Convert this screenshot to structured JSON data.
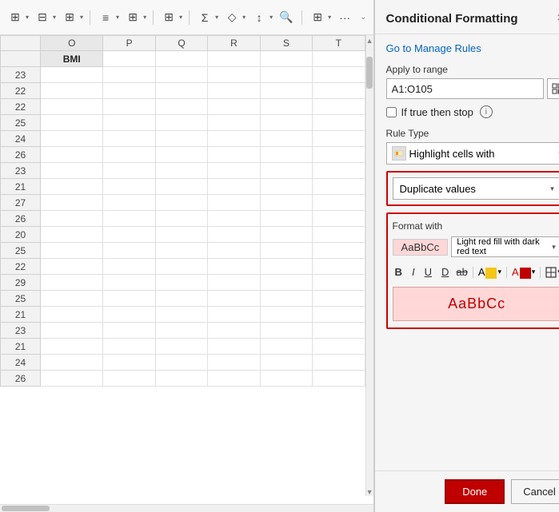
{
  "toolbar": {
    "icons": [
      "⊞",
      "⊟",
      "⊞",
      "≡",
      "⊞",
      "⊞",
      "Σ",
      "◇",
      "↕",
      "🔍",
      "⊞",
      "···"
    ]
  },
  "spreadsheet": {
    "columns": [
      "O",
      "P",
      "Q",
      "R",
      "S",
      "T"
    ],
    "header_row": "BMI",
    "rows": [
      {
        "row_num": "23",
        "o_val": ""
      },
      {
        "row_num": "22",
        "o_val": ""
      },
      {
        "row_num": "22",
        "o_val": ""
      },
      {
        "row_num": "25",
        "o_val": ""
      },
      {
        "row_num": "24",
        "o_val": ""
      },
      {
        "row_num": "26",
        "o_val": ""
      },
      {
        "row_num": "23",
        "o_val": ""
      },
      {
        "row_num": "21",
        "o_val": ""
      },
      {
        "row_num": "27",
        "o_val": ""
      },
      {
        "row_num": "26",
        "o_val": ""
      },
      {
        "row_num": "20",
        "o_val": ""
      },
      {
        "row_num": "25",
        "o_val": ""
      },
      {
        "row_num": "22",
        "o_val": ""
      },
      {
        "row_num": "29",
        "o_val": ""
      },
      {
        "row_num": "25",
        "o_val": ""
      },
      {
        "row_num": "21",
        "o_val": ""
      },
      {
        "row_num": "23",
        "o_val": ""
      },
      {
        "row_num": "21",
        "o_val": ""
      },
      {
        "row_num": "24",
        "o_val": ""
      },
      {
        "row_num": "26",
        "o_val": ""
      }
    ]
  },
  "panel": {
    "title": "Conditional Formatting",
    "close_label": "×",
    "manage_rules_link": "Go to Manage Rules",
    "apply_to_range_label": "Apply to range",
    "range_value": "A1:O105",
    "if_true_then_stop_label": "If true then stop",
    "rule_type_label": "Rule Type",
    "rule_type_icon_label": "⊞",
    "rule_type_value": "Highlight cells with",
    "duplicate_values_label": "Duplicate values",
    "format_with_label": "Format with",
    "format_preview_label": "AaBbCc",
    "format_desc_value": "Light red fill with dark red text",
    "preview_text": "AaBbCc",
    "format_toolbar": {
      "bold": "B",
      "italic": "I",
      "underline": "U",
      "underline2": "D",
      "strikethrough": "ab",
      "fill_color": "A",
      "text_color": "A",
      "borders": "⊞"
    },
    "done_label": "Done",
    "cancel_label": "Cancel"
  }
}
